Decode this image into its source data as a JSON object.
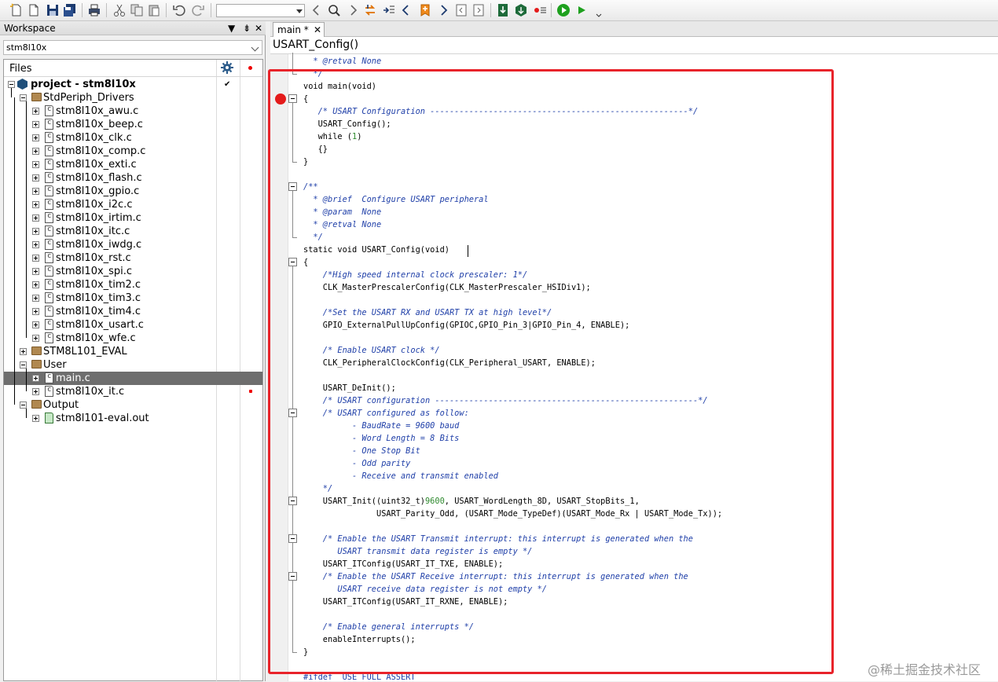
{
  "toolbar": {
    "icons": [
      "new-file-icon",
      "new-doc-icon",
      "save-icon",
      "save-all-icon",
      "print-icon",
      "cut-icon",
      "copy-icon",
      "paste-icon",
      "undo-icon",
      "redo-icon",
      "find-combo",
      "nav-back-icon",
      "search-icon",
      "nav-forward-icon",
      "replace-icon",
      "goto-icon",
      "prev-bookmark-icon",
      "bookmark-icon",
      "next-bookmark-icon",
      "prev-page-icon",
      "next-page-icon",
      "download-icon",
      "build-icon",
      "toggle-icon",
      "go-icon",
      "debug-icon"
    ]
  },
  "workspace": {
    "title": "Workspace",
    "pin": "⇟",
    "close": "✕",
    "configuration": "stm8l10x",
    "files_header": "Files",
    "project_label": "project - stm8l10x",
    "project_check": "✔",
    "tree": {
      "stdperiph": "StdPeriph_Drivers",
      "files": [
        "stm8l10x_awu.c",
        "stm8l10x_beep.c",
        "stm8l10x_clk.c",
        "stm8l10x_comp.c",
        "stm8l10x_exti.c",
        "stm8l10x_flash.c",
        "stm8l10x_gpio.c",
        "stm8l10x_i2c.c",
        "stm8l10x_irtim.c",
        "stm8l10x_itc.c",
        "stm8l10x_iwdg.c",
        "stm8l10x_rst.c",
        "stm8l10x_spi.c",
        "stm8l10x_tim2.c",
        "stm8l10x_tim3.c",
        "stm8l10x_tim4.c",
        "stm8l10x_usart.c",
        "stm8l10x_wfe.c"
      ],
      "eval": "STM8L101_EVAL",
      "user": "User",
      "user_files": [
        "main.c",
        "stm8l10x_it.c"
      ],
      "output": "Output",
      "output_file": "stm8l101-eval.out"
    }
  },
  "editor": {
    "tab_label": "main *",
    "tab_close": "✕",
    "function_label": "USART_Config()",
    "lines": [
      {
        "i": 1,
        "t": "  * @retval None",
        "c": "cmt"
      },
      {
        "i": 1,
        "t": "  */",
        "c": "cmt"
      },
      {
        "i": 0,
        "t": "void main(void)",
        "c": ""
      },
      {
        "i": 0,
        "t": "{",
        "c": ""
      },
      {
        "i": 0,
        "t": "   /* USART Configuration -----------------------------------------------------*/",
        "c": "cmt"
      },
      {
        "i": 0,
        "t": "   USART_Config();",
        "c": ""
      },
      {
        "i": 0,
        "t": "   while (1)",
        "c": "while"
      },
      {
        "i": 0,
        "t": "   {}",
        "c": ""
      },
      {
        "i": 0,
        "t": "}",
        "c": ""
      },
      {
        "i": 0,
        "t": "",
        "c": ""
      },
      {
        "i": 0,
        "t": "/**",
        "c": "cmt"
      },
      {
        "i": 0,
        "t": "  * @brief  Configure USART peripheral",
        "c": "cmt"
      },
      {
        "i": 0,
        "t": "  * @param  None",
        "c": "cmt"
      },
      {
        "i": 0,
        "t": "  * @retval None",
        "c": "cmt"
      },
      {
        "i": 0,
        "t": "  */",
        "c": "cmt"
      },
      {
        "i": 0,
        "t": "static void USART_Config(void)",
        "c": ""
      },
      {
        "i": 0,
        "t": "{",
        "c": ""
      },
      {
        "i": 0,
        "t": "    /*High speed internal clock prescaler: 1*/",
        "c": "cmt"
      },
      {
        "i": 0,
        "t": "    CLK_MasterPrescalerConfig(CLK_MasterPrescaler_HSIDiv1);",
        "c": ""
      },
      {
        "i": 0,
        "t": "",
        "c": ""
      },
      {
        "i": 0,
        "t": "    /*Set the USART RX and USART TX at high level*/",
        "c": "cmt"
      },
      {
        "i": 0,
        "t": "    GPIO_ExternalPullUpConfig(GPIOC,GPIO_Pin_3|GPIO_Pin_4, ENABLE);",
        "c": ""
      },
      {
        "i": 0,
        "t": "",
        "c": ""
      },
      {
        "i": 0,
        "t": "    /* Enable USART clock */",
        "c": "cmt"
      },
      {
        "i": 0,
        "t": "    CLK_PeripheralClockConfig(CLK_Peripheral_USART, ENABLE);",
        "c": ""
      },
      {
        "i": 0,
        "t": "",
        "c": ""
      },
      {
        "i": 0,
        "t": "    USART_DeInit();",
        "c": ""
      },
      {
        "i": 0,
        "t": "    /* USART configuration ------------------------------------------------------*/",
        "c": "cmt"
      },
      {
        "i": 0,
        "t": "    /* USART configured as follow:",
        "c": "cmt"
      },
      {
        "i": 0,
        "t": "          - BaudRate = 9600 baud",
        "c": "cmt"
      },
      {
        "i": 0,
        "t": "          - Word Length = 8 Bits",
        "c": "cmt"
      },
      {
        "i": 0,
        "t": "          - One Stop Bit",
        "c": "cmt"
      },
      {
        "i": 0,
        "t": "          - Odd parity",
        "c": "cmt"
      },
      {
        "i": 0,
        "t": "          - Receive and transmit enabled",
        "c": "cmt"
      },
      {
        "i": 0,
        "t": "    */",
        "c": "cmt"
      },
      {
        "i": 0,
        "t": "    USART_Init((uint32_t)9600, USART_WordLength_8D, USART_StopBits_1,",
        "c": "usartinit"
      },
      {
        "i": 0,
        "t": "               USART_Parity_Odd, (USART_Mode_TypeDef)(USART_Mode_Rx | USART_Mode_Tx));",
        "c": ""
      },
      {
        "i": 0,
        "t": "",
        "c": ""
      },
      {
        "i": 0,
        "t": "    /* Enable the USART Transmit interrupt: this interrupt is generated when the",
        "c": "cmt"
      },
      {
        "i": 0,
        "t": "       USART transmit data register is empty */",
        "c": "cmt"
      },
      {
        "i": 0,
        "t": "    USART_ITConfig(USART_IT_TXE, ENABLE);",
        "c": ""
      },
      {
        "i": 0,
        "t": "    /* Enable the USART Receive interrupt: this interrupt is generated when the",
        "c": "cmt"
      },
      {
        "i": 0,
        "t": "       USART receive data register is not empty */",
        "c": "cmt"
      },
      {
        "i": 0,
        "t": "    USART_ITConfig(USART_IT_RXNE, ENABLE);",
        "c": ""
      },
      {
        "i": 0,
        "t": "",
        "c": ""
      },
      {
        "i": 0,
        "t": "    /* Enable general interrupts */",
        "c": "cmt"
      },
      {
        "i": 0,
        "t": "    enableInterrupts();",
        "c": ""
      },
      {
        "i": 0,
        "t": "}",
        "c": ""
      },
      {
        "i": 0,
        "t": "",
        "c": ""
      },
      {
        "i": 0,
        "t": "#ifdef  USE_FULL_ASSERT",
        "c": "pp"
      }
    ]
  },
  "watermark": "@稀土掘金技术社区",
  "colors": {
    "highlight_box": "#e8232a",
    "breakpoint": "#e41b1b",
    "comment": "#1f3fa8",
    "number": "#2f8a2f",
    "selection": "#6e6e6e"
  }
}
